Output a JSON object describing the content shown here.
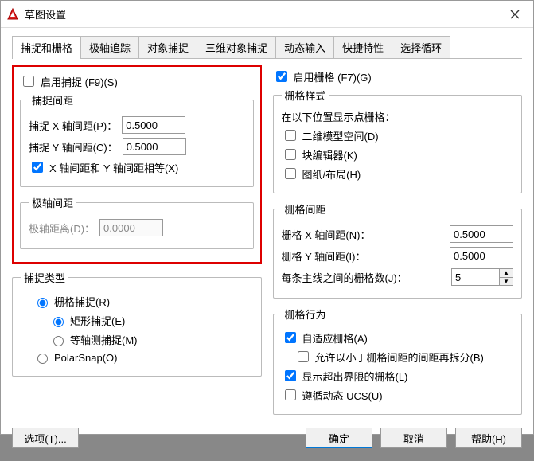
{
  "window": {
    "title": "草图设置"
  },
  "tabs": [
    "捕捉和栅格",
    "极轴追踪",
    "对象捕捉",
    "三维对象捕捉",
    "动态输入",
    "快捷特性",
    "选择循环"
  ],
  "activeTab": 0,
  "left": {
    "enableSnap": {
      "label": "启用捕捉 (F9)(S)",
      "checked": false
    },
    "snapGroup": {
      "legend": "捕捉间距",
      "xLabel": "捕捉 X 轴间距(P)：",
      "xValue": "0.5000",
      "yLabel": "捕捉 Y 轴间距(C)：",
      "yValue": "0.5000",
      "equal": {
        "label": "X 轴间距和 Y 轴间距相等(X)",
        "checked": true
      }
    },
    "polarGroup": {
      "legend": "极轴间距",
      "distLabel": "极轴距离(D)：",
      "distValue": "0.0000"
    },
    "snapTypeGroup": {
      "legend": "捕捉类型",
      "gridSnap": {
        "label": "栅格捕捉(R)",
        "selected": true
      },
      "rectSnap": {
        "label": "矩形捕捉(E)",
        "selected": true
      },
      "isoSnap": {
        "label": "等轴测捕捉(M)",
        "selected": false
      },
      "polarSnap": {
        "label": "PolarSnap(O)",
        "selected": false
      }
    }
  },
  "right": {
    "enableGrid": {
      "label": "启用栅格 (F7)(G)",
      "checked": true
    },
    "styleGroup": {
      "legend": "栅格样式",
      "subhead": "在以下位置显示点栅格：",
      "model": {
        "label": "二维模型空间(D)",
        "checked": false
      },
      "block": {
        "label": "块编辑器(K)",
        "checked": false
      },
      "layout": {
        "label": "图纸/布局(H)",
        "checked": false
      }
    },
    "spacingGroup": {
      "legend": "栅格间距",
      "xLabel": "栅格 X 轴间距(N)：",
      "xValue": "0.5000",
      "yLabel": "栅格 Y 轴间距(I)：",
      "yValue": "0.5000",
      "majorLabel": "每条主线之间的栅格数(J)：",
      "majorValue": "5"
    },
    "behaviorGroup": {
      "legend": "栅格行为",
      "adaptive": {
        "label": "自适应栅格(A)",
        "checked": true
      },
      "subdiv": {
        "label": "允许以小于栅格间距的间距再拆分(B)",
        "checked": false
      },
      "beyond": {
        "label": "显示超出界限的栅格(L)",
        "checked": true
      },
      "ucs": {
        "label": "遵循动态 UCS(U)",
        "checked": false
      }
    }
  },
  "footer": {
    "options": "选项(T)...",
    "ok": "确定",
    "cancel": "取消",
    "help": "帮助(H)"
  }
}
